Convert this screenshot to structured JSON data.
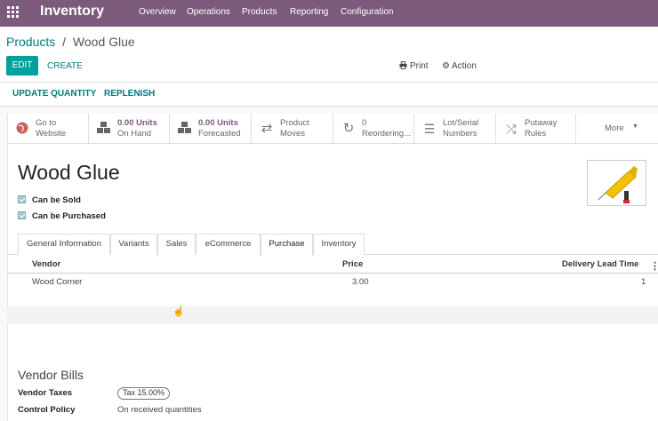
{
  "app": {
    "title": "Inventory",
    "brand_color": "#7c5a7c",
    "menu": [
      "Overview",
      "Operations",
      "Products",
      "Reporting",
      "Configuration"
    ]
  },
  "breadcrumb": {
    "parent": "Products",
    "separator": "/",
    "current": "Wood Glue"
  },
  "toolbar": {
    "edit": "EDIT",
    "create": "CREATE",
    "print": "Print",
    "action": "Action"
  },
  "statusbar": {
    "update_quantity": "UPDATE QUANTITY",
    "replenish": "REPLENISH"
  },
  "smart_buttons": [
    {
      "icon": "globe-icon",
      "line1": "Go to",
      "line2": "Website"
    },
    {
      "icon": "cubes-icon",
      "line1": "0.00 Units",
      "line2": "On Hand"
    },
    {
      "icon": "cubes-icon",
      "line1": "0.00 Units",
      "line2": "Forecasted"
    },
    {
      "icon": "exchange-icon",
      "line1": "Product",
      "line2": "Moves"
    },
    {
      "icon": "refresh-icon",
      "line1": "0",
      "line2": "Reordering..."
    },
    {
      "icon": "list-icon",
      "line1": "Lot/Serial",
      "line2": "Numbers"
    },
    {
      "icon": "random-icon",
      "line1": "Putaway",
      "line2": "Rules"
    }
  ],
  "more": "More",
  "product": {
    "name": "Wood Glue",
    "can_be_sold": "Can be Sold",
    "can_be_purchased": "Can be Purchased",
    "image_icon": "glue-tube-icon"
  },
  "tabs": [
    "General Information",
    "Variants",
    "Sales",
    "eCommerce",
    "Purchase",
    "Inventory"
  ],
  "active_tab": "Purchase",
  "vendor_table": {
    "headers": {
      "vendor": "Vendor",
      "price": "Price",
      "lead_time": "Delivery Lead Time"
    },
    "rows": [
      {
        "vendor": "Wood Corner",
        "price": "3.00",
        "lead_time": "1"
      }
    ]
  },
  "vendor_bills": {
    "title": "Vendor Bills",
    "taxes_label": "Vendor Taxes",
    "tax_tag": "Tax 15.00%",
    "policy_label": "Control Policy",
    "policy_value": "On received quantities"
  }
}
